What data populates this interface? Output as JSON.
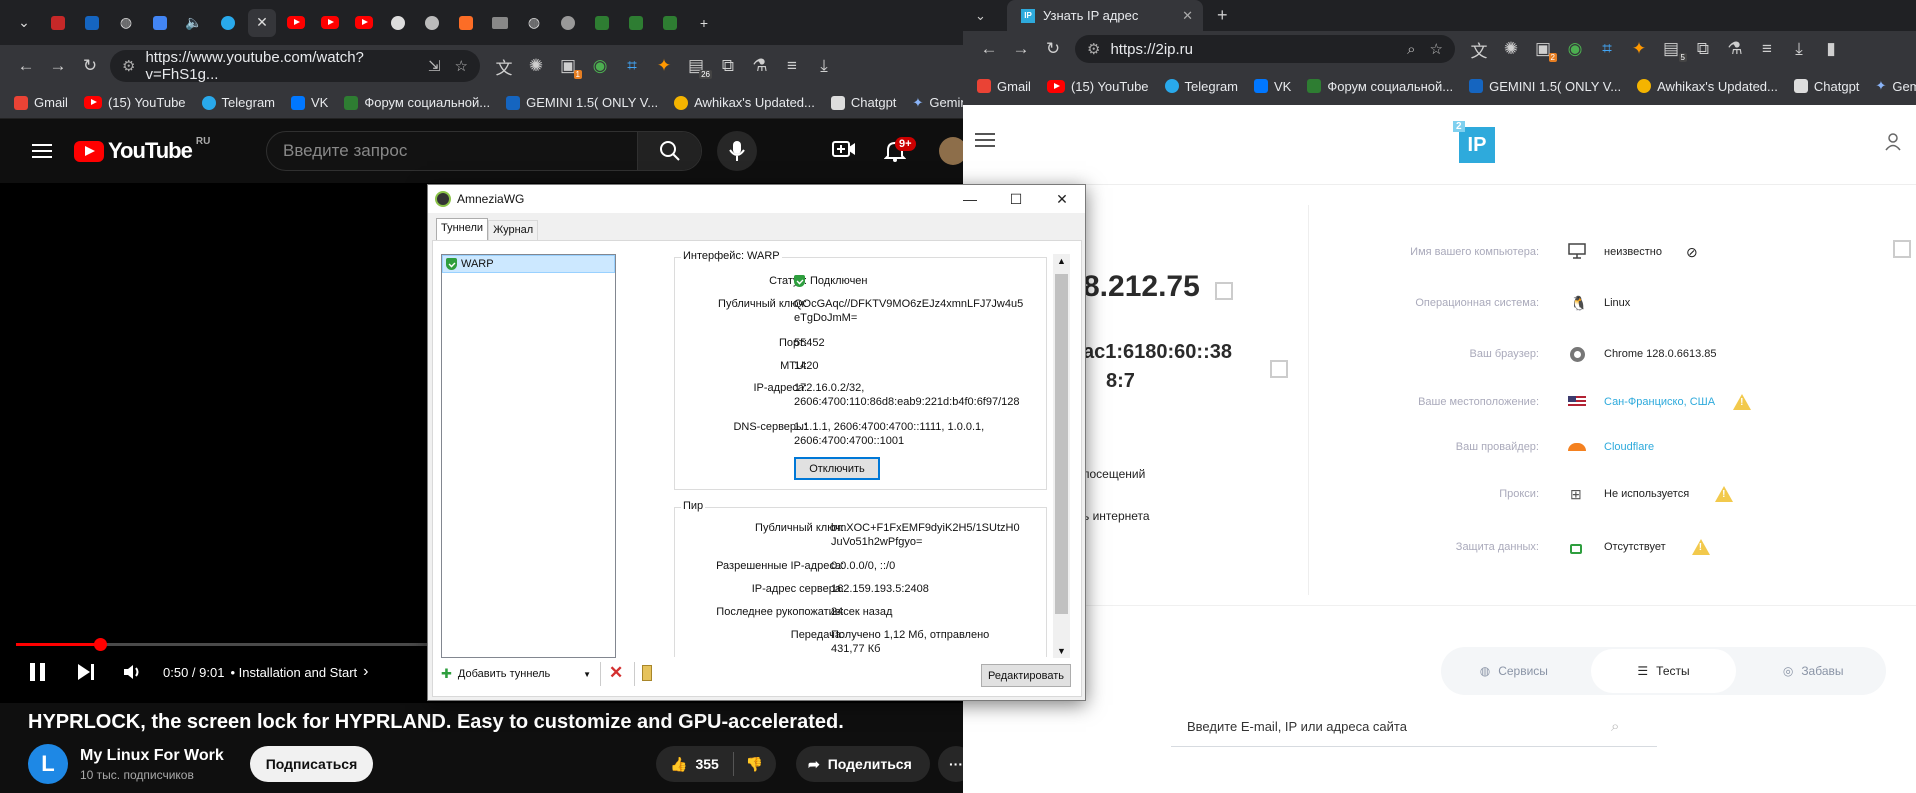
{
  "left_browser": {
    "url": "https://www.youtube.com/watch?v=FhS1g...",
    "bookmarks": [
      "Gmail",
      "(15) YouTube",
      "Telegram",
      "VK",
      "Форум социальной...",
      "GEMINI 1.5( ONLY V...",
      "Awhikax's Updated...",
      "Chatgpt",
      "Gemini"
    ],
    "badges": {
      "ext1": "1",
      "ext2": "26"
    }
  },
  "youtube": {
    "logo": "YouTube",
    "region": "RU",
    "search_placeholder": "Введите запрос",
    "notif_count": "9+",
    "time": "0:50 / 9:01",
    "chapter": "• Installation and Start",
    "chapter_arrow": "›",
    "progress": 0.089,
    "video_title": "HYPRLOCK, the screen lock for HYPRLAND. Easy to customize and GPU-accelerated.",
    "channel": "My Linux For Work",
    "subscribers": "10 тыс. подписчиков",
    "subscribe": "Подписаться",
    "likes": "355",
    "share": "Поделиться",
    "more": "···"
  },
  "right_browser": {
    "tab_title": "Узнать IP адрес",
    "url": "https://2ip.ru",
    "bookmarks": [
      "Gmail",
      "(15) YouTube",
      "Telegram",
      "VK",
      "Форум социальной...",
      "GEMINI 1.5( ONLY V...",
      "Awhikax's Updated...",
      "Chatgpt",
      "Gemini"
    ],
    "badges": {
      "ext1": "2",
      "ext2": "5"
    }
  },
  "site": {
    "logo_small": "2",
    "logo": "IP",
    "ipv4": "8.212.75",
    "ipv6_line1": "ac1:6180:60::38",
    "ipv6_line2": "8:7",
    "left_link1": "посещений",
    "left_link2": "ь интернета",
    "rows": [
      {
        "label": "Имя вашего компьютера:",
        "value": "неизвестно"
      },
      {
        "label": "Операционная система:",
        "value": "Linux"
      },
      {
        "label": "Ваш браузер:",
        "value": "Chrome 128.0.6613.85"
      },
      {
        "label": "Ваше местоположение:",
        "value": "Сан-Франциско, США"
      },
      {
        "label": "Ваш провайдер:",
        "value": "Cloudflare"
      },
      {
        "label": "Прокси:",
        "value": "Не используется"
      },
      {
        "label": "Защита данных:",
        "value": "Отсутствует"
      }
    ],
    "tabs": [
      "Сервисы",
      "Тесты",
      "Забавы"
    ],
    "search_placeholder": "Введите E-mail, IP или адреса сайта"
  },
  "dialog": {
    "title": "AmneziaWG",
    "tabs": [
      "Туннели",
      "Журнал"
    ],
    "tunnel": "WARP",
    "interface_legend": "Интерфейс: WARP",
    "interface": [
      {
        "k": "Статус:",
        "v": "Подключен"
      },
      {
        "k": "Публичный ключ:",
        "v": "QOcGAqc//DFKTV9MO6zEJz4xmnLFJ7Jw4u5",
        "v2": "eTgDoJmM="
      },
      {
        "k": "Порт:",
        "v": "55452"
      },
      {
        "k": "MTU:",
        "v": "1420"
      },
      {
        "k": "IP-адреса:",
        "v": "172.16.0.2/32,",
        "v2": "2606:4700:110:86d8:eab9:221d:b4f0:6f97/128"
      },
      {
        "k": "DNS-серверы:",
        "v": "1.1.1.1, 2606:4700:4700::1111, 1.0.0.1,",
        "v2": "2606:4700:4700::1001"
      }
    ],
    "disconnect": "Отключить",
    "peer_legend": "Пир",
    "peer": [
      {
        "k": "Публичный ключ:",
        "v": "bmXOC+F1FxEMF9dyiK2H5/1SUtzH0",
        "v2": "JuVo51h2wPfgyo="
      },
      {
        "k": "Разрешенные IP-адреса:",
        "v": "0.0.0.0/0, ::/0"
      },
      {
        "k": "IP-адрес сервера:",
        "v": "162.159.193.5:2408"
      },
      {
        "k": "Последнее рукопожатие:",
        "v": "24сек назад"
      },
      {
        "k": "Передача:",
        "v": "Получено 1,12 Мб, отправлено",
        "v2": "431,77 Кб"
      }
    ],
    "add_tunnel": "Добавить туннель",
    "edit": "Редактировать"
  },
  "colors": {
    "yt_red": "#ff0000",
    "accent_2ip": "#2eaadc",
    "warn": "#f2c94c",
    "shield": "#2e9e3e",
    "link": "#2eaadc"
  }
}
